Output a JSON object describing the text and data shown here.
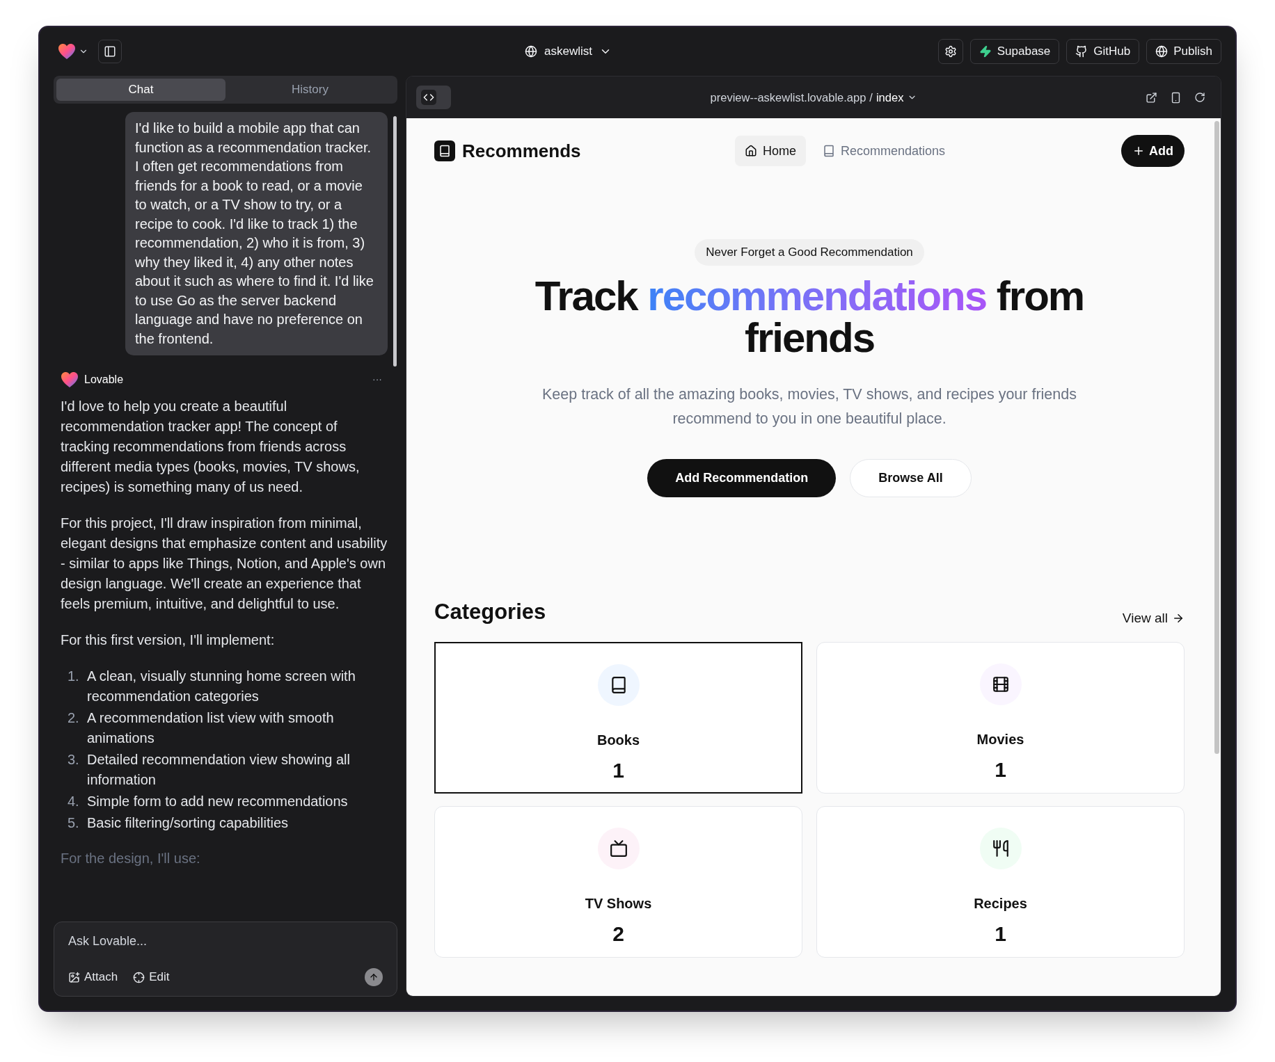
{
  "top_bar": {
    "project": "askewlist",
    "buttons": [
      {
        "kind": "settings"
      },
      {
        "kind": "supabase",
        "label": "Supabase"
      },
      {
        "kind": "github",
        "label": "GitHub"
      },
      {
        "kind": "publish",
        "label": "Publish"
      }
    ]
  },
  "chat_tabs": [
    {
      "label": "Chat",
      "selected": true
    },
    {
      "label": "History",
      "selected": false
    }
  ],
  "user_message": "I'd like to build a mobile app that can function as a recommendation tracker. I often get recommendations from friends for a book to read, or a movie to watch, or a TV show to try, or a recipe to cook. I'd like to track 1) the recommendation, 2) who it is from, 3) why they liked it, 4) any other notes about it such as where to find it. I'd like to use Go as the server backend language and have no preference on the frontend.",
  "assistant": {
    "name": "Lovable",
    "menu": "···",
    "paragraphs": [
      "I'd love to help you create a beautiful recommendation tracker app! The concept of tracking recommendations from friends across different media types (books, movies, TV shows, recipes) is something many of us need.",
      "For this project, I'll draw inspiration from minimal, elegant designs that emphasize content and usability - similar to apps like Things, Notion, and Apple's own design language. We'll create an experience that feels premium, intuitive, and delightful to use.",
      "For this first version, I'll implement:"
    ],
    "list": [
      {
        "number": "1.",
        "text": "A clean, visually stunning home screen with recommendation categories"
      },
      {
        "number": "2.",
        "text": "A recommendation list view with smooth animations"
      },
      {
        "number": "3.",
        "text": "Detailed recommendation view showing all information"
      },
      {
        "number": "4.",
        "text": "Simple form to add new recommendations"
      },
      {
        "number": "5.",
        "text": "Basic filtering/sorting capabilities"
      }
    ],
    "faded_line": "For the design, I'll use:"
  },
  "composer": {
    "placeholder": "Ask Lovable...",
    "actions": [
      {
        "kind": "attach",
        "label": "Attach"
      },
      {
        "kind": "edit",
        "label": "Edit"
      }
    ]
  },
  "preview_bar": {
    "host": "preview--askewlist.lovable.app",
    "separator": "/",
    "page": "index"
  },
  "site": {
    "brand": "Recommends",
    "nav": [
      {
        "kind": "home",
        "label": "Home",
        "selected": true
      },
      {
        "kind": "book",
        "label": "Recommendations",
        "selected": false
      }
    ],
    "add_button": "Add",
    "hero": {
      "badge": "Never Forget a Good Recommendation",
      "title_start": "Track",
      "title_highlight": "recommendations",
      "title_end": "from friends",
      "subtitle": "Keep track of all the amazing books, movies, TV shows, and recipes your friends recommend to you in one beautiful place.",
      "primary_button": "Add Recommendation",
      "secondary_button": "Browse All"
    },
    "categories_title": "Categories",
    "view_all": "View all",
    "categories": [
      {
        "kind": "book",
        "name": "Books",
        "count": "1",
        "color": "#eff6ff",
        "selected": true
      },
      {
        "kind": "film",
        "name": "Movies",
        "count": "1",
        "color": "#faf5ff",
        "selected": false
      },
      {
        "kind": "tv",
        "name": "TV Shows",
        "count": "2",
        "color": "#fdf2f8",
        "selected": false
      },
      {
        "kind": "utensils",
        "name": "Recipes",
        "count": "1",
        "color": "#f0fdf4",
        "selected": false
      }
    ]
  }
}
